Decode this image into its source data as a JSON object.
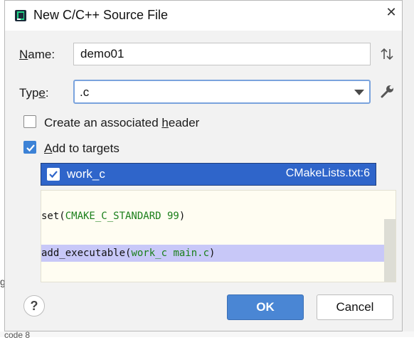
{
  "background": {
    "left_char": "g",
    "bottom_text": "code 8"
  },
  "dialog": {
    "title": "New C/C++ Source File",
    "close_icon": "close-icon"
  },
  "name": {
    "label_hotkey": "N",
    "label_rest": "ame:",
    "value": "demo01"
  },
  "type": {
    "label_pre": "Typ",
    "label_hotkey": "e",
    "label_rest": ":",
    "value": ".c"
  },
  "options": {
    "header": {
      "label_pre": "Create an associated ",
      "label_hotkey": "h",
      "label_rest": "eader",
      "checked": false
    },
    "targets": {
      "label_hotkey": "A",
      "label_rest": "dd to targets",
      "checked": true
    }
  },
  "target_list": [
    {
      "name": "work_c",
      "file": "CMakeLists.txt:6",
      "checked": true
    }
  ],
  "code": {
    "line1": {
      "fn": "set(",
      "arg": "CMAKE_C_STANDARD 99",
      "close": ")"
    },
    "line2": {
      "fn": "add_executable(",
      "arg": "work_c main.c",
      "close": ")"
    }
  },
  "buttons": {
    "help": "?",
    "ok": "OK",
    "cancel": "Cancel"
  },
  "colors": {
    "accent": "#4a86d4",
    "selection": "#2f65ca",
    "highlight": "#c8c8f8",
    "code_green": "#1a7f1a"
  }
}
